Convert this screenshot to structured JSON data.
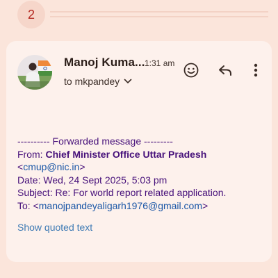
{
  "thread": {
    "collapsed_count": "2"
  },
  "message": {
    "sender_name": "Manoj Kuma...",
    "time": "1:31 am",
    "recipient": "to mkpandey",
    "forwarded_header": "---------- Forwarded message ---------",
    "from_label": "From:",
    "from_name": "Chief Minister Office Uttar Pradesh",
    "from_email_open": "<",
    "from_email": "cmup@nic.in",
    "from_email_close": ">",
    "date_line": "Date: Wed, 24 Sept 2025, 5:03 pm",
    "subject_line": "Subject: Re: For world report related application.",
    "to_label": "To: <",
    "to_email": "manojpandeyaligarh1976@gmail.com",
    "to_close": ">",
    "show_quoted": "Show quoted text"
  },
  "icons": {
    "avatar": "profile-photo",
    "chevron": "chevron-down-icon",
    "emoji": "emoji-reaction-icon",
    "reply": "reply-icon",
    "more": "more-vert-icon"
  },
  "colors": {
    "background": "#fbe5db",
    "card": "#fdf1ec",
    "body_text": "#46107a",
    "link": "#1a56a6",
    "show_quoted": "#3d7ab4",
    "badge_text": "#b3261e"
  }
}
